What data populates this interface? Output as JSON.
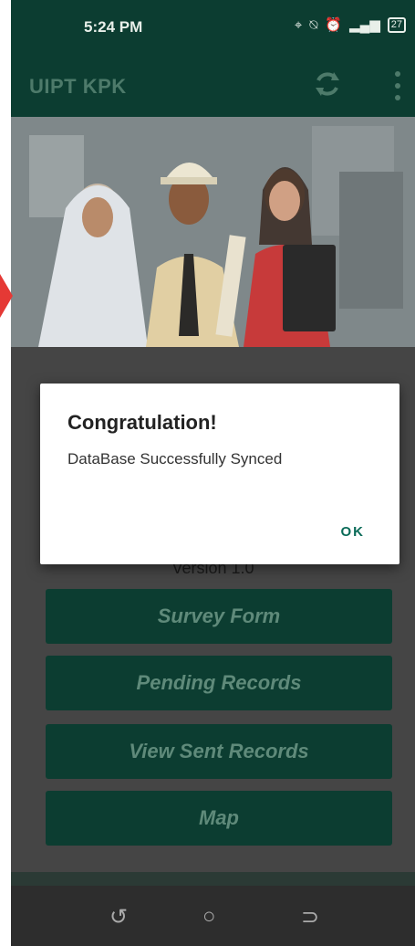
{
  "status_bar": {
    "time": "5:24 PM",
    "battery": "27"
  },
  "app_bar": {
    "title": "UIPT KPK",
    "sync_icon": "sync-icon",
    "menu_icon": "more-vert-icon"
  },
  "main": {
    "version": "Version 1.0",
    "buttons": [
      {
        "label": "Survey Form"
      },
      {
        "label": "Pending Records"
      },
      {
        "label": "View Sent Records"
      },
      {
        "label": "Map"
      }
    ]
  },
  "dialog": {
    "title": "Congratulation!",
    "message": "DataBase Successfully Synced",
    "ok_label": "OK"
  },
  "colors": {
    "primary_dark": "#0c3d31",
    "button_text": "#5f8a7a",
    "dialog_accent": "#0a6b58"
  }
}
